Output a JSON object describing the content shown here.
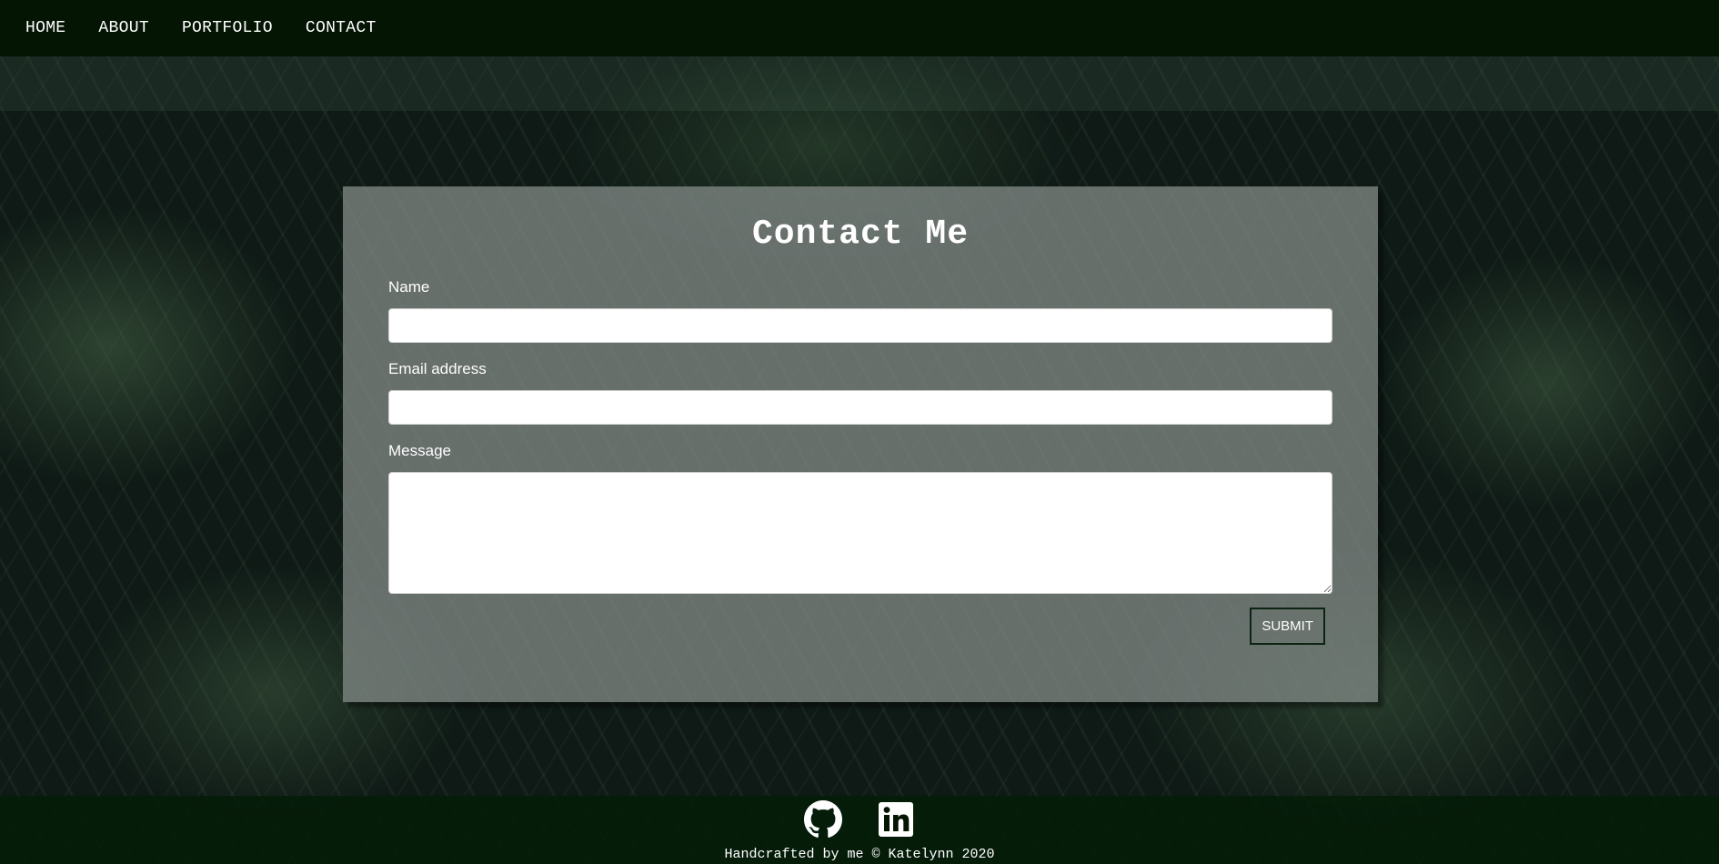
{
  "nav": {
    "items": [
      {
        "label": "HOME"
      },
      {
        "label": "ABOUT"
      },
      {
        "label": "PORTFOLIO"
      },
      {
        "label": "CONTACT"
      }
    ]
  },
  "contact": {
    "title": "Contact Me",
    "name_label": "Name",
    "name_value": "",
    "email_label": "Email address",
    "email_value": "",
    "message_label": "Message",
    "message_value": "",
    "submit_label": "SUBMIT"
  },
  "footer": {
    "social_icons": [
      "github-icon",
      "linkedin-icon"
    ],
    "copyright": "Handcrafted by me © Katelynn 2020"
  },
  "colors": {
    "navbar": "#041504",
    "card": "#808884",
    "text": "#ffffff",
    "button_border": "#0c2414"
  }
}
